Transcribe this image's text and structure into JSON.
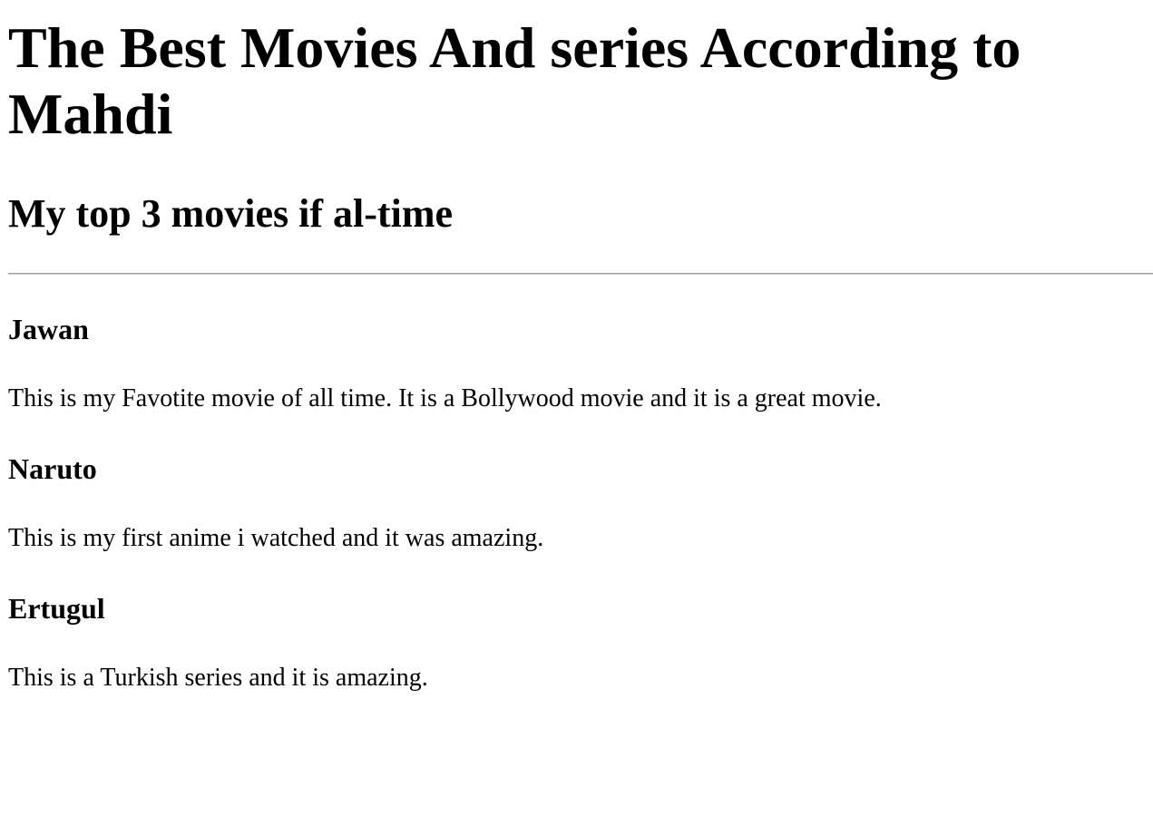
{
  "title": "The Best Movies And series According to Mahdi",
  "subtitle": "My top 3 movies if al-time",
  "items": [
    {
      "name": "Jawan",
      "description": "This is my Favotite movie of all time. It is a Bollywood movie and it is a great movie."
    },
    {
      "name": "Naruto",
      "description": "This is my first anime i watched and it was amazing."
    },
    {
      "name": "Ertugul",
      "description": "This is a Turkish series and it is amazing."
    }
  ]
}
